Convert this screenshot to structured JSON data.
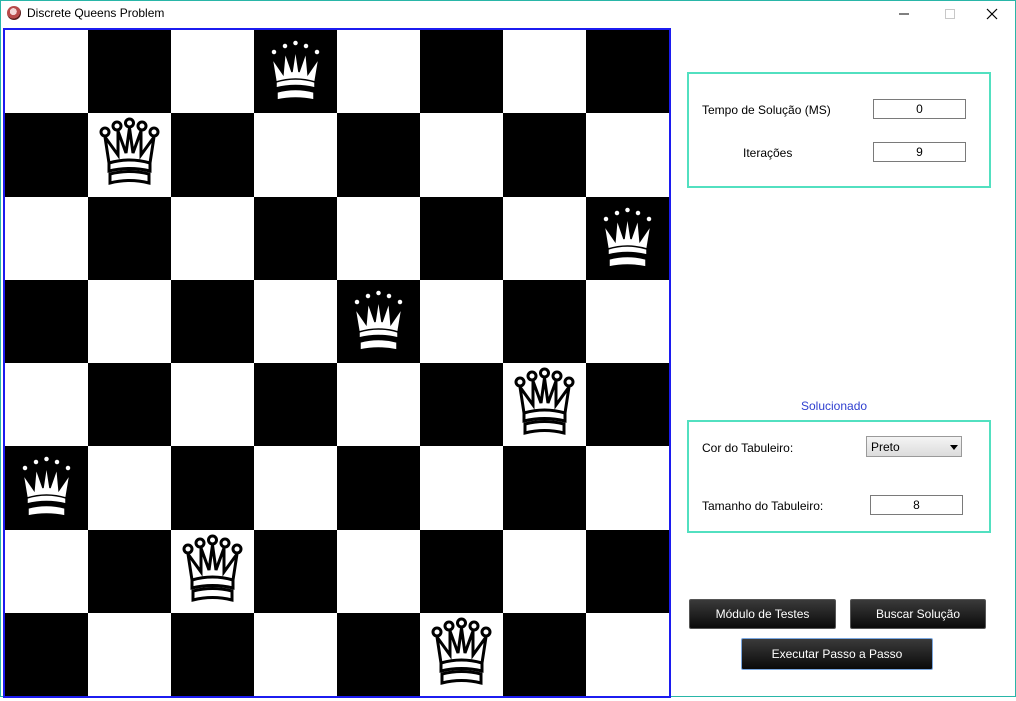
{
  "window": {
    "title": "Discrete Queens Problem",
    "icons": {
      "app": "app-icon",
      "minimize": "minimize-icon",
      "maximize": "maximize-icon",
      "close": "close-icon"
    }
  },
  "board": {
    "size": 8,
    "border_color": "#1c1cf0",
    "dark_color": "#000000",
    "light_color": "#ffffff",
    "queen_icon": "queen-icon",
    "queens": [
      {
        "row": 0,
        "col": 3
      },
      {
        "row": 1,
        "col": 1
      },
      {
        "row": 2,
        "col": 7
      },
      {
        "row": 3,
        "col": 4
      },
      {
        "row": 4,
        "col": 6
      },
      {
        "row": 5,
        "col": 0
      },
      {
        "row": 6,
        "col": 2
      },
      {
        "row": 7,
        "col": 5
      }
    ]
  },
  "stats": {
    "time_label": "Tempo de Solução (MS)",
    "time_value": "0",
    "iterations_label": "Iterações",
    "iterations_value": "9"
  },
  "status": {
    "text": "Solucionado",
    "color": "#3040d0"
  },
  "settings": {
    "color_label": "Cor do Tabuleiro:",
    "color_value": "Preto",
    "size_label": "Tamanho do Tabuleiro:",
    "size_value": "8"
  },
  "buttons": {
    "tests": "Módulo de Testes",
    "search": "Buscar Solução",
    "step": "Executar Passo a Passo"
  },
  "accent_color": "#52e0c0"
}
